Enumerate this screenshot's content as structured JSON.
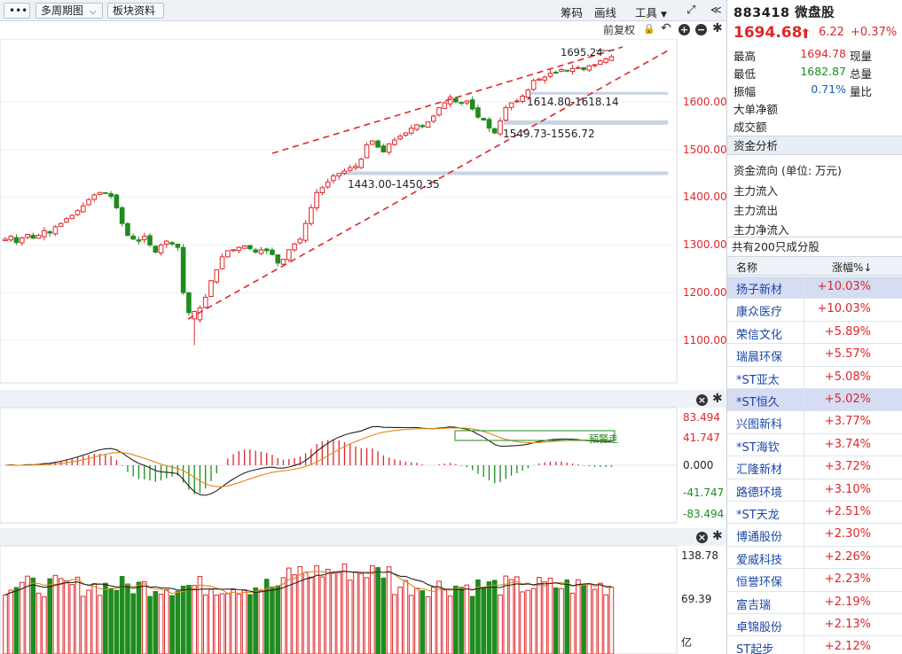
{
  "toolbar": {
    "more_label": "•••",
    "period_label": "多周期图",
    "sector_info_label": "板块资料",
    "chip_label": "筹码",
    "draw_label": "画线",
    "tools_label": "工具"
  },
  "subbar": {
    "adjust_label": "前复权"
  },
  "price_axis": {
    "ticks": [
      "1600.00",
      "1500.00",
      "1400.00",
      "1300.00",
      "1200.00",
      "1100.00"
    ]
  },
  "annotations": {
    "top_label": "1695.24",
    "zone1": "1614.80-1618.14",
    "zone2": "1549.73-1556.72",
    "zone3": "1443.00-1450.35"
  },
  "macd_axis": {
    "ticks": [
      "83.494",
      "41.747",
      "0.000",
      "-41.747",
      "-83.494"
    ],
    "note": "预警走"
  },
  "volume_axis": {
    "ticks": [
      "138.78",
      "69.39",
      "亿"
    ]
  },
  "quote": {
    "code_name": "883418  微盘股",
    "price": "1694.68",
    "change": "6.22",
    "change_pct": "+0.37%",
    "high_label": "最高",
    "high": "1694.78",
    "high_tag": "现量",
    "low_label": "最低",
    "low": "1682.87",
    "low_tag": "总量",
    "amp_label": "振幅",
    "amp": "0.71%",
    "amp_tag": "量比",
    "big_order_label": "大单净额",
    "turnover_label": "成交额"
  },
  "capital": {
    "section_label": "资金分析",
    "flow_title": "资金流向  (单位: 万元)",
    "inflow": "主力流入",
    "outflow": "主力流出",
    "net": "主力净流入"
  },
  "constituents": {
    "count_label": "共有200只成分股",
    "col_name": "名称",
    "col_pct": "涨幅%↓",
    "rows": [
      {
        "name": "扬子新材",
        "pct": "+10.03%"
      },
      {
        "name": "康众医疗",
        "pct": "+10.03%"
      },
      {
        "name": "荣信文化",
        "pct": "+5.89%"
      },
      {
        "name": "瑞晨环保",
        "pct": "+5.57%"
      },
      {
        "name": "*ST亚太",
        "pct": "+5.08%"
      },
      {
        "name": "*ST恒久",
        "pct": "+5.02%"
      },
      {
        "name": "兴图新科",
        "pct": "+3.77%"
      },
      {
        "name": "*ST海钦",
        "pct": "+3.74%"
      },
      {
        "name": "汇隆新材",
        "pct": "+3.72%"
      },
      {
        "name": "路德环境",
        "pct": "+3.10%"
      },
      {
        "name": "*ST天龙",
        "pct": "+2.51%"
      },
      {
        "name": "博通股份",
        "pct": "+2.30%"
      },
      {
        "name": "爱威科技",
        "pct": "+2.26%"
      },
      {
        "name": "恒誉环保",
        "pct": "+2.23%"
      },
      {
        "name": "富吉瑞",
        "pct": "+2.19%"
      },
      {
        "name": "卓锦股份",
        "pct": "+2.13%"
      },
      {
        "name": "ST起步",
        "pct": "+2.12%"
      }
    ]
  },
  "colors": {
    "up": "#e0262a",
    "down": "#1e8c1e",
    "trendline": "#e0262a",
    "zone": "#c9d3e3"
  },
  "chart_data": {
    "type": "candlestick",
    "closes": [
      1312,
      1318,
      1305,
      1315,
      1322,
      1314,
      1320,
      1330,
      1325,
      1338,
      1345,
      1355,
      1362,
      1372,
      1382,
      1395,
      1405,
      1410,
      1408,
      1402,
      1378,
      1345,
      1320,
      1312,
      1308,
      1318,
      1300,
      1285,
      1300,
      1308,
      1302,
      1295,
      1200,
      1158,
      1145,
      1168,
      1190,
      1225,
      1248,
      1275,
      1288,
      1290,
      1295,
      1298,
      1292,
      1285,
      1290,
      1288,
      1280,
      1262,
      1270,
      1290,
      1302,
      1312,
      1345,
      1378,
      1410,
      1420,
      1432,
      1445,
      1450,
      1455,
      1462,
      1465,
      1480,
      1510,
      1518,
      1505,
      1495,
      1512,
      1520,
      1528,
      1535,
      1545,
      1552,
      1548,
      1558,
      1570,
      1588,
      1598,
      1610,
      1600,
      1598,
      1602,
      1585,
      1568,
      1562,
      1545,
      1535,
      1560,
      1588,
      1598,
      1602,
      1612,
      1625,
      1645,
      1648,
      1652,
      1660,
      1662,
      1668,
      1665,
      1670,
      1672,
      1668,
      1676,
      1678,
      1686,
      1690,
      1694.68
    ]
  }
}
